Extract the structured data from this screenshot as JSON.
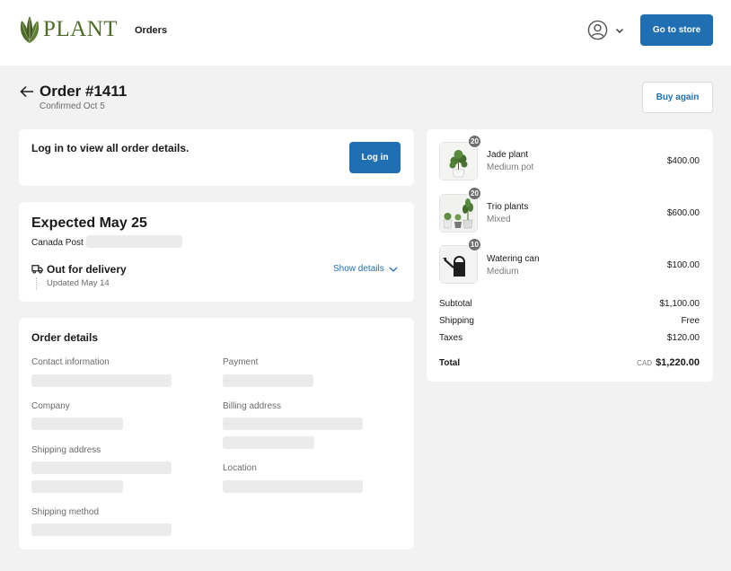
{
  "header": {
    "logo_text": "PLANT",
    "nav_orders": "Orders",
    "go_to_store": "Go to store"
  },
  "order": {
    "title": "Order #1411",
    "confirmed": "Confirmed Oct 5",
    "buy_again": "Buy again"
  },
  "login": {
    "text": "Log in to view all order details.",
    "button": "Log in"
  },
  "delivery": {
    "expected": "Expected May 25",
    "carrier": "Canada Post",
    "status": "Out for delivery",
    "updated": "Updated May 14",
    "show_details": "Show details"
  },
  "details": {
    "title": "Order details",
    "contact": "Contact information",
    "payment": "Payment",
    "company": "Company",
    "billing": "Billing address",
    "shipping_address": "Shipping address",
    "location": "Location",
    "shipping_method": "Shipping method"
  },
  "items": [
    {
      "name": "Jade plant",
      "variant": "Medium pot",
      "price": "$400.00",
      "qty": "20",
      "icon": "jade-plant-icon"
    },
    {
      "name": "Trio plants",
      "variant": "Mixed",
      "price": "$600.00",
      "qty": "20",
      "icon": "trio-plants-icon"
    },
    {
      "name": "Watering can",
      "variant": "Medium",
      "price": "$100.00",
      "qty": "10",
      "icon": "watering-can-icon"
    }
  ],
  "summary": {
    "subtotal_label": "Subtotal",
    "subtotal": "$1,100.00",
    "shipping_label": "Shipping",
    "shipping": "Free",
    "taxes_label": "Taxes",
    "taxes": "$120.00",
    "total_label": "Total",
    "currency": "CAD",
    "total": "$1,220.00"
  },
  "colors": {
    "accent": "#1f6fb2",
    "brand": "#4f6b2a",
    "background": "#f2f2f2"
  }
}
